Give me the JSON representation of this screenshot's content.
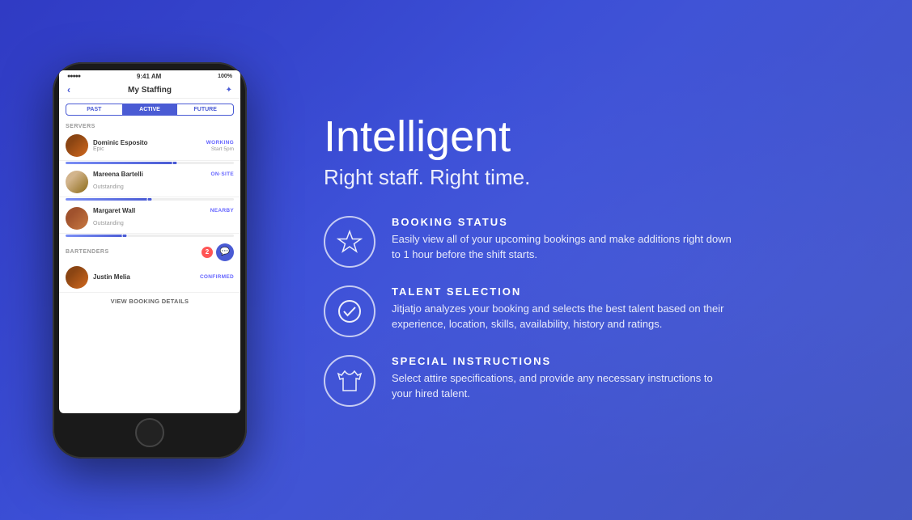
{
  "background": {
    "overlay_color": "rgba(50,60,200,0.8)"
  },
  "hero": {
    "title": "Intelligent",
    "subtitle": "Right staff. Right time."
  },
  "phone": {
    "status_bar": {
      "signal": "●●●●●",
      "wifi": "WiFi",
      "time": "9:41 AM",
      "battery": "100%"
    },
    "nav": {
      "back": "‹",
      "title": "My Staffing",
      "icon": "✦"
    },
    "tabs": [
      "PAST",
      "ACTIVE",
      "FUTURE"
    ],
    "active_tab": "ACTIVE",
    "sections": [
      {
        "label": "SERVERS",
        "staff": [
          {
            "name": "Dominic Esposito",
            "sub": "Epic",
            "status": "WORKING",
            "time": "Start 5pm",
            "progress": 65,
            "marker": 65
          },
          {
            "name": "Mareena Bartelli",
            "sub": "Outstanding",
            "status": "ON SITE",
            "progress": 50,
            "marker": 50
          },
          {
            "name": "Margaret Wall",
            "sub": "Outstanding",
            "status": "NEARBY",
            "progress": 35,
            "marker": 35
          }
        ]
      },
      {
        "label": "BARTENDERS",
        "notification_count": "2",
        "staff": [
          {
            "name": "Justin Melia",
            "status": "CONFIRMED",
            "progress": 0
          }
        ]
      }
    ],
    "view_booking": "VIEW BOOKING DETAILS"
  },
  "features": [
    {
      "id": "booking-status",
      "title": "BOOKING STATUS",
      "description": "Easily view all of your upcoming bookings and make additions right down to 1 hour before the shift starts.",
      "icon": "star"
    },
    {
      "id": "talent-selection",
      "title": "TALENT SELECTION",
      "description": "Jitjatjo analyzes your booking and selects the best talent based on their experience, location, skills, availability, history and ratings.",
      "icon": "check"
    },
    {
      "id": "special-instructions",
      "title": "SPECIAL INSTRUCTIONS",
      "description": "Select attire specifications, and provide any necessary instructions to your hired talent.",
      "icon": "shirt"
    }
  ]
}
